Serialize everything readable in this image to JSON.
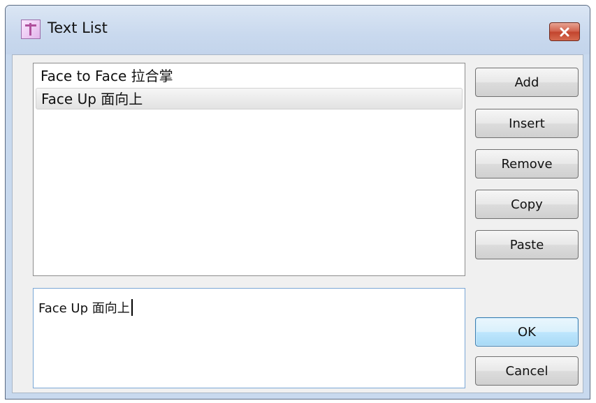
{
  "window": {
    "title": "Text List",
    "close_icon": "close-icon"
  },
  "list": {
    "items": [
      {
        "label": "Face to Face 拉合掌",
        "selected": false
      },
      {
        "label": "Face Up 面向上",
        "selected": true
      }
    ]
  },
  "edit": {
    "value": "Face Up 面向上"
  },
  "buttons": {
    "add": "Add",
    "insert": "Insert",
    "remove": "Remove",
    "copy": "Copy",
    "paste": "Paste",
    "ok": "OK",
    "cancel": "Cancel"
  },
  "colors": {
    "titlebar": "#c9d9ee",
    "close_button": "#c9452e",
    "selection": "#e8e8e8",
    "default_button": "#bee6fd"
  }
}
